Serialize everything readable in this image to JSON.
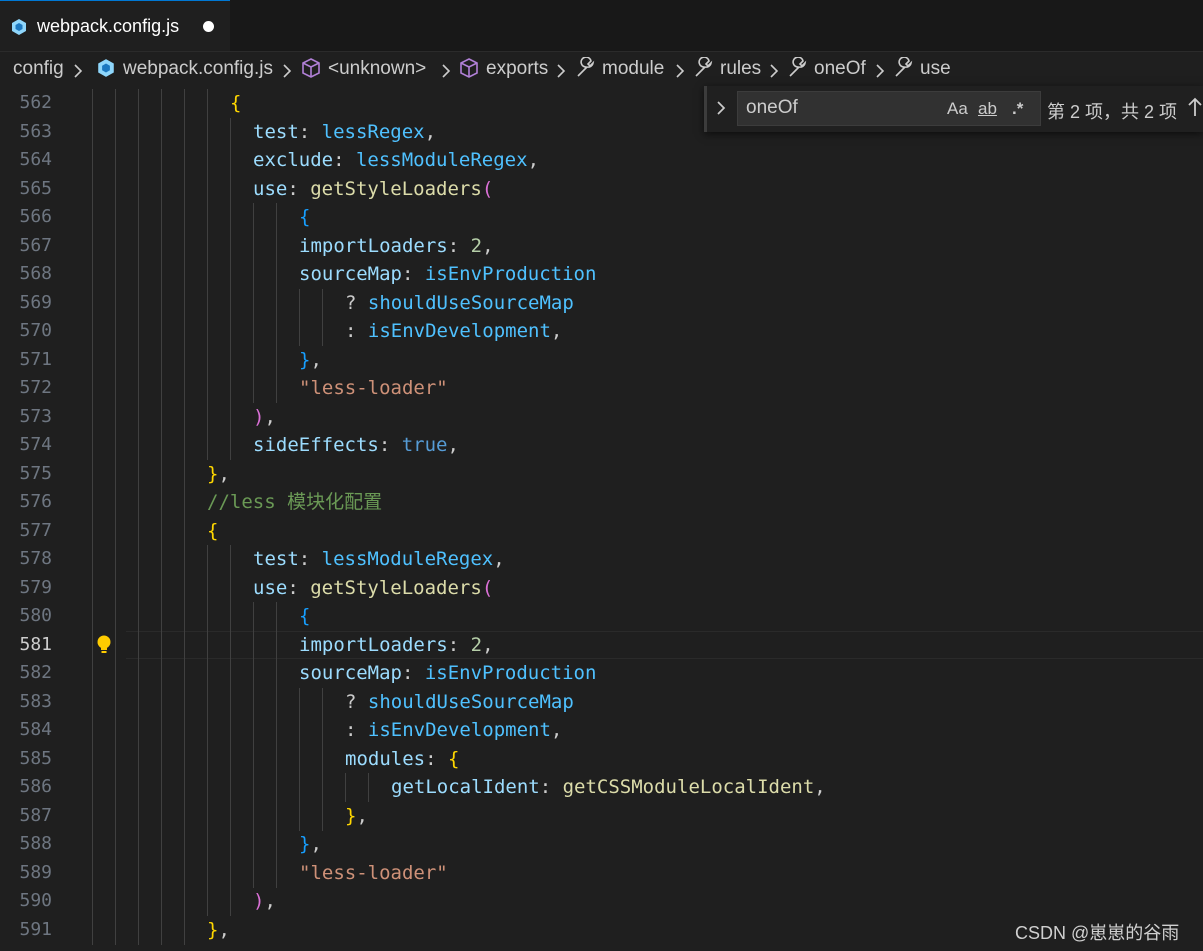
{
  "tab": {
    "filename": "webpack.config.js",
    "dirty": true
  },
  "breadcrumbs": [
    {
      "label": "config",
      "icon": null
    },
    {
      "label": "webpack.config.js",
      "icon": "webpack-icon"
    },
    {
      "label": "<unknown>",
      "icon": "cube-icon"
    },
    {
      "label": "exports",
      "icon": "cube-icon"
    },
    {
      "label": "module",
      "icon": "wrench-icon"
    },
    {
      "label": "rules",
      "icon": "wrench-icon"
    },
    {
      "label": "oneOf",
      "icon": "wrench-icon"
    },
    {
      "label": "use",
      "icon": "wrench-icon"
    }
  ],
  "find": {
    "query": "oneOf",
    "match_case_label": "Aa",
    "whole_word_label": "ab",
    "regex_label": ".*",
    "result_text": "第 2 项，共 2 项"
  },
  "editor": {
    "active_line": 581,
    "lines": [
      {
        "n": 562,
        "code": [
          [
            "b1",
            "{"
          ]
        ]
      },
      {
        "n": 563,
        "code": [
          [
            "k-prop",
            "test"
          ],
          [
            "",
            ": "
          ],
          [
            "k-var",
            "lessRegex"
          ],
          [
            "",
            ","
          ]
        ]
      },
      {
        "n": 564,
        "code": [
          [
            "k-prop",
            "exclude"
          ],
          [
            "",
            ": "
          ],
          [
            "k-var",
            "lessModuleRegex"
          ],
          [
            "",
            ","
          ]
        ]
      },
      {
        "n": 565,
        "code": [
          [
            "k-prop",
            "use"
          ],
          [
            "",
            ": "
          ],
          [
            "k-func",
            "getStyleLoaders"
          ],
          [
            "b2",
            "("
          ]
        ]
      },
      {
        "n": 566,
        "code": [
          [
            "b3",
            "{"
          ]
        ]
      },
      {
        "n": 567,
        "code": [
          [
            "k-prop",
            "importLoaders"
          ],
          [
            "",
            ": "
          ],
          [
            "k-num",
            "2"
          ],
          [
            "",
            ","
          ]
        ]
      },
      {
        "n": 568,
        "code": [
          [
            "k-prop",
            "sourceMap"
          ],
          [
            "",
            ": "
          ],
          [
            "k-var",
            "isEnvProduction"
          ]
        ]
      },
      {
        "n": 569,
        "code": [
          [
            "",
            "? "
          ],
          [
            "k-var",
            "shouldUseSourceMap"
          ]
        ]
      },
      {
        "n": 570,
        "code": [
          [
            "",
            ": "
          ],
          [
            "k-var",
            "isEnvDevelopment"
          ],
          [
            "",
            ","
          ]
        ]
      },
      {
        "n": 571,
        "code": [
          [
            "b3",
            "}"
          ],
          [
            "",
            ","
          ]
        ]
      },
      {
        "n": 572,
        "code": [
          [
            "k-str",
            "\"less-loader\""
          ]
        ]
      },
      {
        "n": 573,
        "code": [
          [
            "b2",
            ")"
          ],
          [
            "",
            ","
          ]
        ]
      },
      {
        "n": 574,
        "code": [
          [
            "k-prop",
            "sideEffects"
          ],
          [
            "",
            ": "
          ],
          [
            "k-bool",
            "true"
          ],
          [
            "",
            ","
          ]
        ]
      },
      {
        "n": 575,
        "code": [
          [
            "b1",
            "}"
          ],
          [
            "",
            ","
          ]
        ]
      },
      {
        "n": 576,
        "code": [
          [
            "k-com",
            "//less 模块化配置"
          ]
        ]
      },
      {
        "n": 577,
        "code": [
          [
            "b1",
            "{"
          ]
        ]
      },
      {
        "n": 578,
        "code": [
          [
            "k-prop",
            "test"
          ],
          [
            "",
            ": "
          ],
          [
            "k-var",
            "lessModuleRegex"
          ],
          [
            "",
            ","
          ]
        ]
      },
      {
        "n": 579,
        "code": [
          [
            "k-prop",
            "use"
          ],
          [
            "",
            ": "
          ],
          [
            "k-func",
            "getStyleLoaders"
          ],
          [
            "b2",
            "("
          ]
        ]
      },
      {
        "n": 580,
        "code": [
          [
            "b3",
            "{"
          ]
        ]
      },
      {
        "n": 581,
        "code": [
          [
            "k-prop",
            "importLoaders"
          ],
          [
            "",
            ": "
          ],
          [
            "k-num",
            "2"
          ],
          [
            "",
            ","
          ]
        ]
      },
      {
        "n": 582,
        "code": [
          [
            "k-prop",
            "sourceMap"
          ],
          [
            "",
            ": "
          ],
          [
            "k-var",
            "isEnvProduction"
          ]
        ]
      },
      {
        "n": 583,
        "code": [
          [
            "",
            "? "
          ],
          [
            "k-var",
            "shouldUseSourceMap"
          ]
        ]
      },
      {
        "n": 584,
        "code": [
          [
            "",
            ": "
          ],
          [
            "k-var",
            "isEnvDevelopment"
          ],
          [
            "",
            ","
          ]
        ]
      },
      {
        "n": 585,
        "code": [
          [
            "k-prop",
            "modules"
          ],
          [
            "",
            ": "
          ],
          [
            "b1",
            "{"
          ]
        ]
      },
      {
        "n": 586,
        "code": [
          [
            "k-prop",
            "getLocalIdent"
          ],
          [
            "",
            ": "
          ],
          [
            "k-func",
            "getCSSModuleLocalIdent"
          ],
          [
            "",
            ","
          ]
        ]
      },
      {
        "n": 587,
        "code": [
          [
            "b1",
            "}"
          ],
          [
            "",
            ","
          ]
        ]
      },
      {
        "n": 588,
        "code": [
          [
            "b3",
            "}"
          ],
          [
            "",
            ","
          ]
        ]
      },
      {
        "n": 589,
        "code": [
          [
            "k-str",
            "\"less-loader\""
          ]
        ]
      },
      {
        "n": 590,
        "code": [
          [
            "b2",
            ")"
          ],
          [
            "",
            ","
          ]
        ]
      },
      {
        "n": 591,
        "code": [
          [
            "b1",
            "}"
          ],
          [
            "",
            ","
          ]
        ]
      }
    ]
  },
  "watermark": "CSDN @崽崽的谷雨",
  "colors": {
    "background": "#1f1f1f",
    "property": "#9cdcfe",
    "variable": "#4fc1ff",
    "function": "#dcdcaa",
    "string": "#ce9178",
    "comment": "#6a9955"
  }
}
